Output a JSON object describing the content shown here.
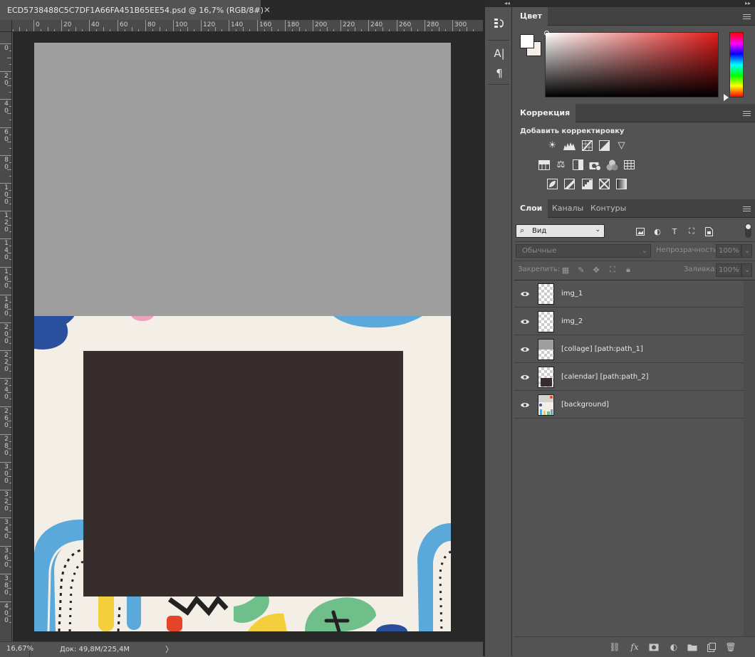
{
  "document": {
    "tab_title": "ECD5738488C5C7DF1A66FA451B65EE54.psd @ 16,7% (RGB/8#)",
    "close_glyph": "✕",
    "background_color": "#f4efe6",
    "collage_color": "#9e9e9e",
    "calendar_color": "#372d2d"
  },
  "rulers": {
    "horizontal_labels": [
      "0",
      "20",
      "40",
      "60",
      "80",
      "100",
      "120",
      "140",
      "160",
      "180",
      "200",
      "220",
      "240",
      "260",
      "280",
      "300"
    ],
    "vertical_labels": [
      [
        "0"
      ],
      [
        "2",
        "0"
      ],
      [
        "4",
        "0"
      ],
      [
        "6",
        "0"
      ],
      [
        "8",
        "0"
      ],
      [
        "1",
        "0",
        "0"
      ],
      [
        "1",
        "2",
        "0"
      ],
      [
        "1",
        "4",
        "0"
      ],
      [
        "1",
        "6",
        "0"
      ],
      [
        "1",
        "8",
        "0"
      ],
      [
        "2",
        "0",
        "0"
      ],
      [
        "2",
        "2",
        "0"
      ],
      [
        "2",
        "4",
        "0"
      ],
      [
        "2",
        "6",
        "0"
      ],
      [
        "2",
        "8",
        "0"
      ],
      [
        "3",
        "0",
        "0"
      ],
      [
        "3",
        "2",
        "0"
      ],
      [
        "3",
        "4",
        "0"
      ],
      [
        "3",
        "6",
        "0"
      ],
      [
        "3",
        "8",
        "0"
      ],
      [
        "4",
        "0",
        "0"
      ]
    ]
  },
  "status": {
    "zoom": "16,67%",
    "doc_size": "Док: 49,8M/225,4M",
    "arrow": "〉"
  },
  "color_panel": {
    "tab": "Цвет",
    "foreground": "#ffffff",
    "background": "#f4efe6",
    "hue": "#e21a1a"
  },
  "adjustments_panel": {
    "tab": "Коррекция",
    "heading": "Добавить корректировку",
    "rows": [
      [
        "brightness-contrast",
        "levels",
        "curves",
        "exposure",
        "vibrance"
      ],
      [
        "hue-saturation",
        "color-balance",
        "black-white",
        "photo-filter",
        "channel-mixer",
        "color-lookup"
      ],
      [
        "invert",
        "posterize",
        "threshold",
        "selective-color",
        "gradient-map"
      ]
    ]
  },
  "layers_panel": {
    "tabs": [
      "Слои",
      "Каналы",
      "Контуры"
    ],
    "filter_kind": "Вид",
    "blend_mode": "Обычные",
    "opacity_label": "Непрозрачность:",
    "opacity_value": "100%",
    "lock_label": "Закрепить:",
    "fill_label": "Заливка:",
    "fill_value": "100%",
    "layers": [
      {
        "name": "img_1",
        "thumb": "transparent"
      },
      {
        "name": "img_2",
        "thumb": "transparent"
      },
      {
        "name": "[collage] [path:path_1]",
        "thumb": "collage"
      },
      {
        "name": "[calendar] [path:path_2]",
        "thumb": "calendar"
      },
      {
        "name": "[background]",
        "thumb": "background"
      }
    ]
  },
  "toolstrip": {
    "items": [
      "history-icon",
      "character-icon",
      "paragraph-icon"
    ]
  },
  "footer_icons": [
    "link-layers-icon",
    "fx-icon",
    "add-mask-icon",
    "adjustment-layer-icon",
    "new-group-icon",
    "new-layer-icon",
    "delete-layer-icon"
  ]
}
